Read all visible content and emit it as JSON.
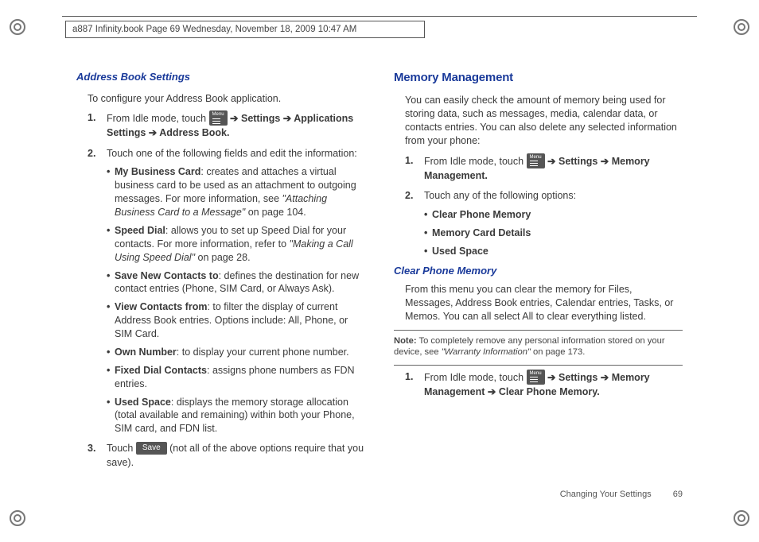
{
  "header": "a887 Infinity.book  Page 69  Wednesday, November 18, 2009  10:47 AM",
  "left": {
    "title": "Address Book Settings",
    "intro": "To configure your Address Book application.",
    "step1_pre": "From Idle mode, touch ",
    "step1_post": " ➔ Settings ➔ Applications Settings ➔ Address Book",
    "step2": "Touch one of the following fields and edit the information:",
    "bullets": [
      {
        "term": "My Business Card",
        "desc": ": creates and attaches a virtual business card to be used as an attachment to outgoing messages. For more information, see ",
        "link": "\"Attaching Business Card to a Message\"",
        "tail": " on page 104."
      },
      {
        "term": "Speed Dial",
        "desc": ": allows you to set up Speed Dial for your contacts. For more information, refer to ",
        "link": "\"Making a Call Using Speed Dial\"",
        "tail": " on page 28."
      },
      {
        "term": "Save New Contacts to",
        "desc": ": defines the destination for new contact entries (Phone, SIM Card, or Always Ask).",
        "link": "",
        "tail": ""
      },
      {
        "term": "View Contacts from",
        "desc": ": to filter the display of current Address Book entries. Options include: All, Phone, or SIM Card.",
        "link": "",
        "tail": ""
      },
      {
        "term": "Own Number",
        "desc": ": to display your current phone number.",
        "link": "",
        "tail": ""
      },
      {
        "term": "Fixed Dial Contacts",
        "desc": ": assigns phone numbers as FDN entries.",
        "link": "",
        "tail": ""
      },
      {
        "term": "Used Space",
        "desc": ": displays the memory storage allocation (total available and remaining) within both your Phone, SIM card, and FDN list.",
        "link": "",
        "tail": ""
      }
    ],
    "step3_pre": "Touch ",
    "step3_save": "Save",
    "step3_post": " (not all of the above options require that you save)."
  },
  "right": {
    "title": "Memory Management",
    "intro": "You can easily check the amount of memory being used for storing data, such as messages, media, calendar data, or contacts entries. You can also delete any selected information from your phone:",
    "step1_pre": "From Idle mode, touch ",
    "step1_post": "  ➔ Settings  ➔ Memory Management",
    "step2": "Touch any of the following options:",
    "bullets": [
      "Clear Phone Memory",
      "Memory Card Details",
      "Used Space"
    ],
    "sub_title": "Clear Phone Memory",
    "sub_body": "From this menu you can clear the memory for Files, Messages, Address Book entries, Calendar entries, Tasks, or Memos. You can all select All to clear everything listed.",
    "note_label": "Note:",
    "note_body": " To completely remove any personal information stored on your device, see ",
    "note_link": "\"Warranty Information\"",
    "note_tail": " on page 173.",
    "step_b_pre": "From Idle mode, touch ",
    "step_b_post": " ➔ Settings  ➔ Memory Management ➔ Clear Phone Memory"
  },
  "footer": {
    "section": "Changing Your Settings",
    "page": "69"
  },
  "icons": {
    "menu_label": "Menu"
  }
}
